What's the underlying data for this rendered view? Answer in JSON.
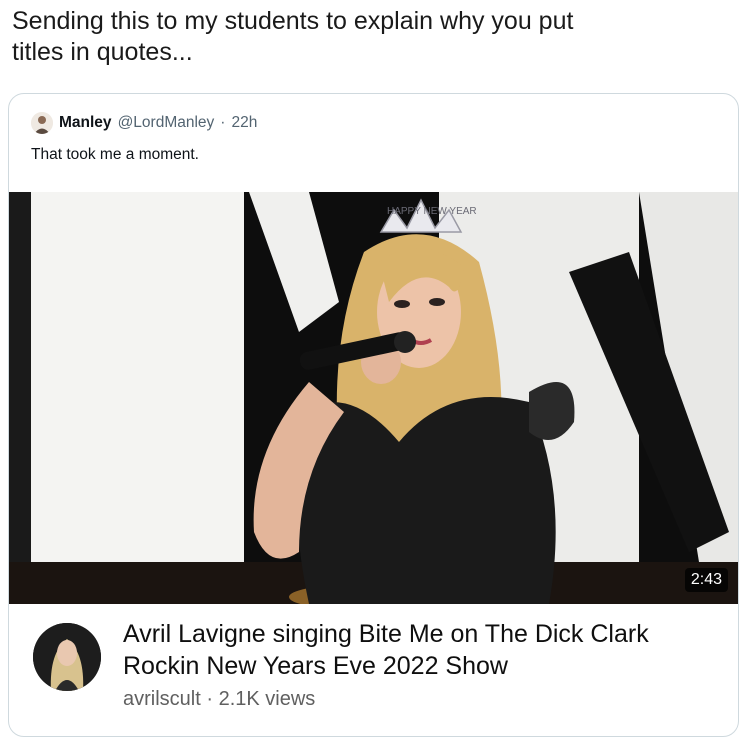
{
  "tweet": {
    "text": "Sending this to my students to explain why you put\ntitles in quotes..."
  },
  "quote": {
    "avatar_icon": "person-avatar-icon",
    "name": "Manley",
    "handle": "@LordManley",
    "separator": "·",
    "time": "22h",
    "text": "That took me a moment."
  },
  "video": {
    "crown_text": "HAPPY NEW YEAR",
    "duration": "2:43",
    "title": "Avril Lavigne singing Bite Me on The Dick Clark Rockin New Years Eve 2022 Show",
    "channel": "avrilscult",
    "separator": "·",
    "views": "2.1K views"
  },
  "colors": {
    "handle_gray": "#536471",
    "card_border": "#cfd9de",
    "hair_pink": "#d6305a"
  }
}
